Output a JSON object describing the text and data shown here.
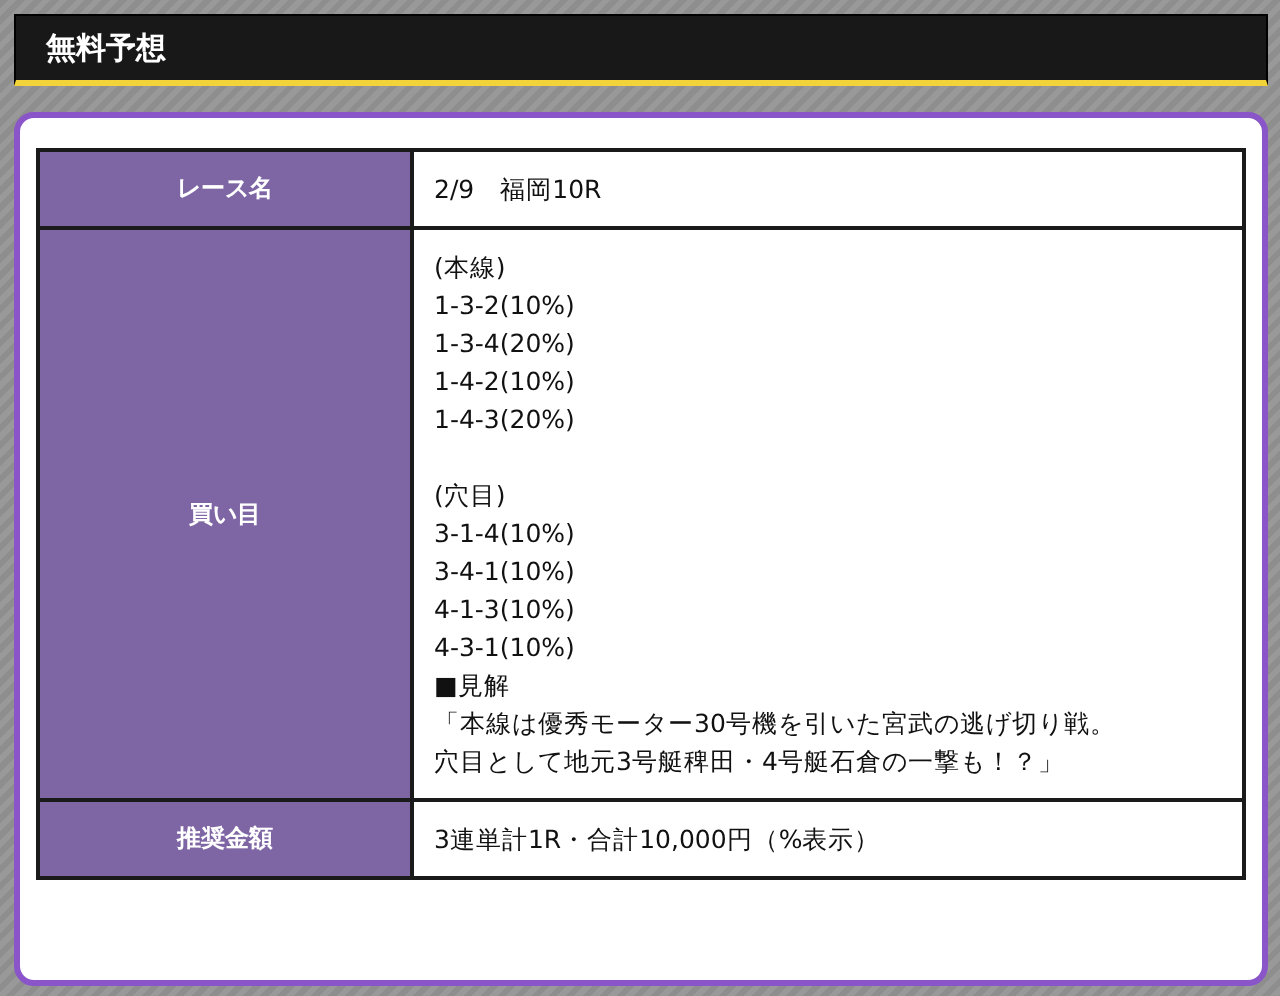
{
  "header": {
    "title": "無料予想"
  },
  "table": {
    "rows": [
      {
        "label": "レース名",
        "groups": [
          [
            "2/9　福岡10R"
          ]
        ]
      },
      {
        "label": "買い目",
        "groups": [
          [
            "(本線)",
            "1-3-2(10%)",
            "1-3-4(20%)",
            "1-4-2(10%)",
            "1-4-3(20%)"
          ],
          [
            "(穴目)",
            "3-1-4(10%)",
            "3-4-1(10%)",
            "4-1-3(10%)",
            "4-3-1(10%)",
            "■見解",
            "「本線は優秀モーター30号機を引いた宮武の逃げ切り戦。",
            "穴目として地元3号艇稗田・4号艇石倉の一撃も！？」"
          ]
        ]
      },
      {
        "label": "推奨金額",
        "groups": [
          [
            "3連単計1R・合計10,000円（%表示）"
          ]
        ]
      }
    ]
  }
}
